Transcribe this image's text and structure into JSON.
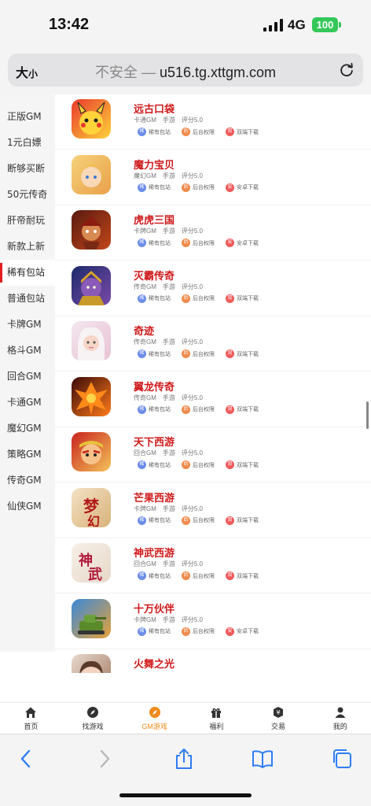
{
  "status": {
    "time": "13:42",
    "network": "4G",
    "battery": "100"
  },
  "urlbar": {
    "text_size": "大",
    "text_size_small": "小",
    "insecure": "不安全 —",
    "domain": "u516.tg.xttgm.com"
  },
  "sidebar": {
    "items": [
      {
        "label": "正版GM"
      },
      {
        "label": "1元白嫖"
      },
      {
        "label": "断够买断"
      },
      {
        "label": "50元传奇"
      },
      {
        "label": "肝帝耐玩"
      },
      {
        "label": "新款上新"
      },
      {
        "label": "稀有包站"
      },
      {
        "label": "普通包站"
      },
      {
        "label": "卡牌GM"
      },
      {
        "label": "格斗GM"
      },
      {
        "label": "回合GM"
      },
      {
        "label": "卡通GM"
      },
      {
        "label": "魔幻GM"
      },
      {
        "label": "策略GM"
      },
      {
        "label": "传奇GM"
      },
      {
        "label": "仙侠GM"
      }
    ],
    "active": "稀有包站"
  },
  "tag_labels": {
    "t1": "稀有包站",
    "t2": "后台权限",
    "t3_double": "双端下载",
    "t3_android": "安卓下载"
  },
  "tag_dots": {
    "t1": "稀",
    "t2": "后",
    "t3_double": "双",
    "t3_android": "安"
  },
  "games": [
    {
      "name": "远古口袋",
      "type": "卡通GM",
      "platform": "手游",
      "rating": "评分5.0",
      "download": "双端下载",
      "icon": "pikachu-icon"
    },
    {
      "name": "魔力宝贝",
      "type": "魔幻GM",
      "platform": "手游",
      "rating": "评分5.0",
      "download": "安卓下载",
      "icon": "angel-icon"
    },
    {
      "name": "虎虎三国",
      "type": "卡牌GM",
      "platform": "手游",
      "rating": "评分5.0",
      "download": "安卓下载",
      "icon": "warrior-icon"
    },
    {
      "name": "灭霸传奇",
      "type": "传奇GM",
      "platform": "手游",
      "rating": "评分5.0",
      "download": "双端下载",
      "icon": "titan-icon"
    },
    {
      "name": "奇迹",
      "type": "传奇GM",
      "platform": "手游",
      "rating": "评分5.0",
      "download": "双端下载",
      "icon": "girl-icon"
    },
    {
      "name": "翼龙传奇",
      "type": "传奇GM",
      "platform": "手游",
      "rating": "评分5.0",
      "download": "双端下载",
      "icon": "dragon-icon"
    },
    {
      "name": "天下西游",
      "type": "回合GM",
      "platform": "手游",
      "rating": "评分5.0",
      "download": "双端下载",
      "icon": "monkey-icon"
    },
    {
      "name": "芒果西游",
      "type": "卡牌GM",
      "platform": "手游",
      "rating": "评分5.0",
      "download": "双端下载",
      "icon": "dream-icon"
    },
    {
      "name": "神武西游",
      "type": "回合GM",
      "platform": "手游",
      "rating": "评分5.0",
      "download": "双端下载",
      "icon": "shenwu-icon"
    },
    {
      "name": "十万伙伴",
      "type": "卡牌GM",
      "platform": "手游",
      "rating": "评分5.0",
      "download": "安卓下载",
      "icon": "tank-icon"
    },
    {
      "name": "火舞之光",
      "type": "",
      "platform": "",
      "rating": "",
      "download": "",
      "icon": "dancer-icon"
    }
  ],
  "dream_text": "梦幻",
  "shenwu_text": "神武",
  "tabbar": [
    {
      "label": "首页",
      "icon": "home-icon"
    },
    {
      "label": "找游戏",
      "icon": "compass-icon"
    },
    {
      "label": "GM游戏",
      "icon": "gm-icon"
    },
    {
      "label": "福利",
      "icon": "gift-icon"
    },
    {
      "label": "交易",
      "icon": "trade-icon"
    },
    {
      "label": "我的",
      "icon": "user-icon"
    }
  ],
  "tabbar_active": "GM游戏",
  "colors": {
    "accent_red": "#d0191a",
    "accent_orange": "#f08a1c",
    "tag_blue": "#6c8de8",
    "tag_orange": "#f08a4b",
    "tag_red": "#ef5a5a"
  }
}
